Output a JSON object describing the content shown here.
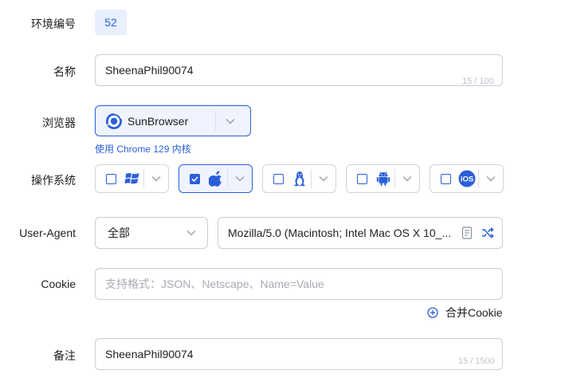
{
  "env_id": {
    "label": "环境编号",
    "value": "52"
  },
  "name": {
    "label": "名称",
    "value": "SheenaPhil90074",
    "counter": "15 / 100"
  },
  "browser": {
    "label": "浏览器",
    "value": "SunBrowser",
    "hint": "使用 Chrome 129 内核"
  },
  "os": {
    "label": "操作系统",
    "options": [
      {
        "name": "Windows",
        "icon": "windows-icon",
        "checked": false
      },
      {
        "name": "macOS",
        "icon": "apple-icon",
        "checked": true
      },
      {
        "name": "Linux",
        "icon": "linux-icon",
        "checked": false
      },
      {
        "name": "Android",
        "icon": "android-icon",
        "checked": false
      },
      {
        "name": "iOS",
        "icon": "ios-icon",
        "checked": false
      }
    ]
  },
  "user_agent": {
    "label": "User-Agent",
    "filter": "全部",
    "value": "Mozilla/5.0 (Macintosh; Intel Mac OS X 10_..."
  },
  "cookie": {
    "label": "Cookie",
    "placeholder": "支持格式：JSON、Netscape、Name=Value",
    "merge_label": "合并Cookie"
  },
  "remark": {
    "label": "备注",
    "value": "SheenaPhil90074",
    "counter": "15 / 1500"
  },
  "colors": {
    "accent": "#2b5fd9",
    "badge_bg": "#e8effd",
    "selected_bg": "#eef3fe",
    "border": "#c9cdd4"
  }
}
